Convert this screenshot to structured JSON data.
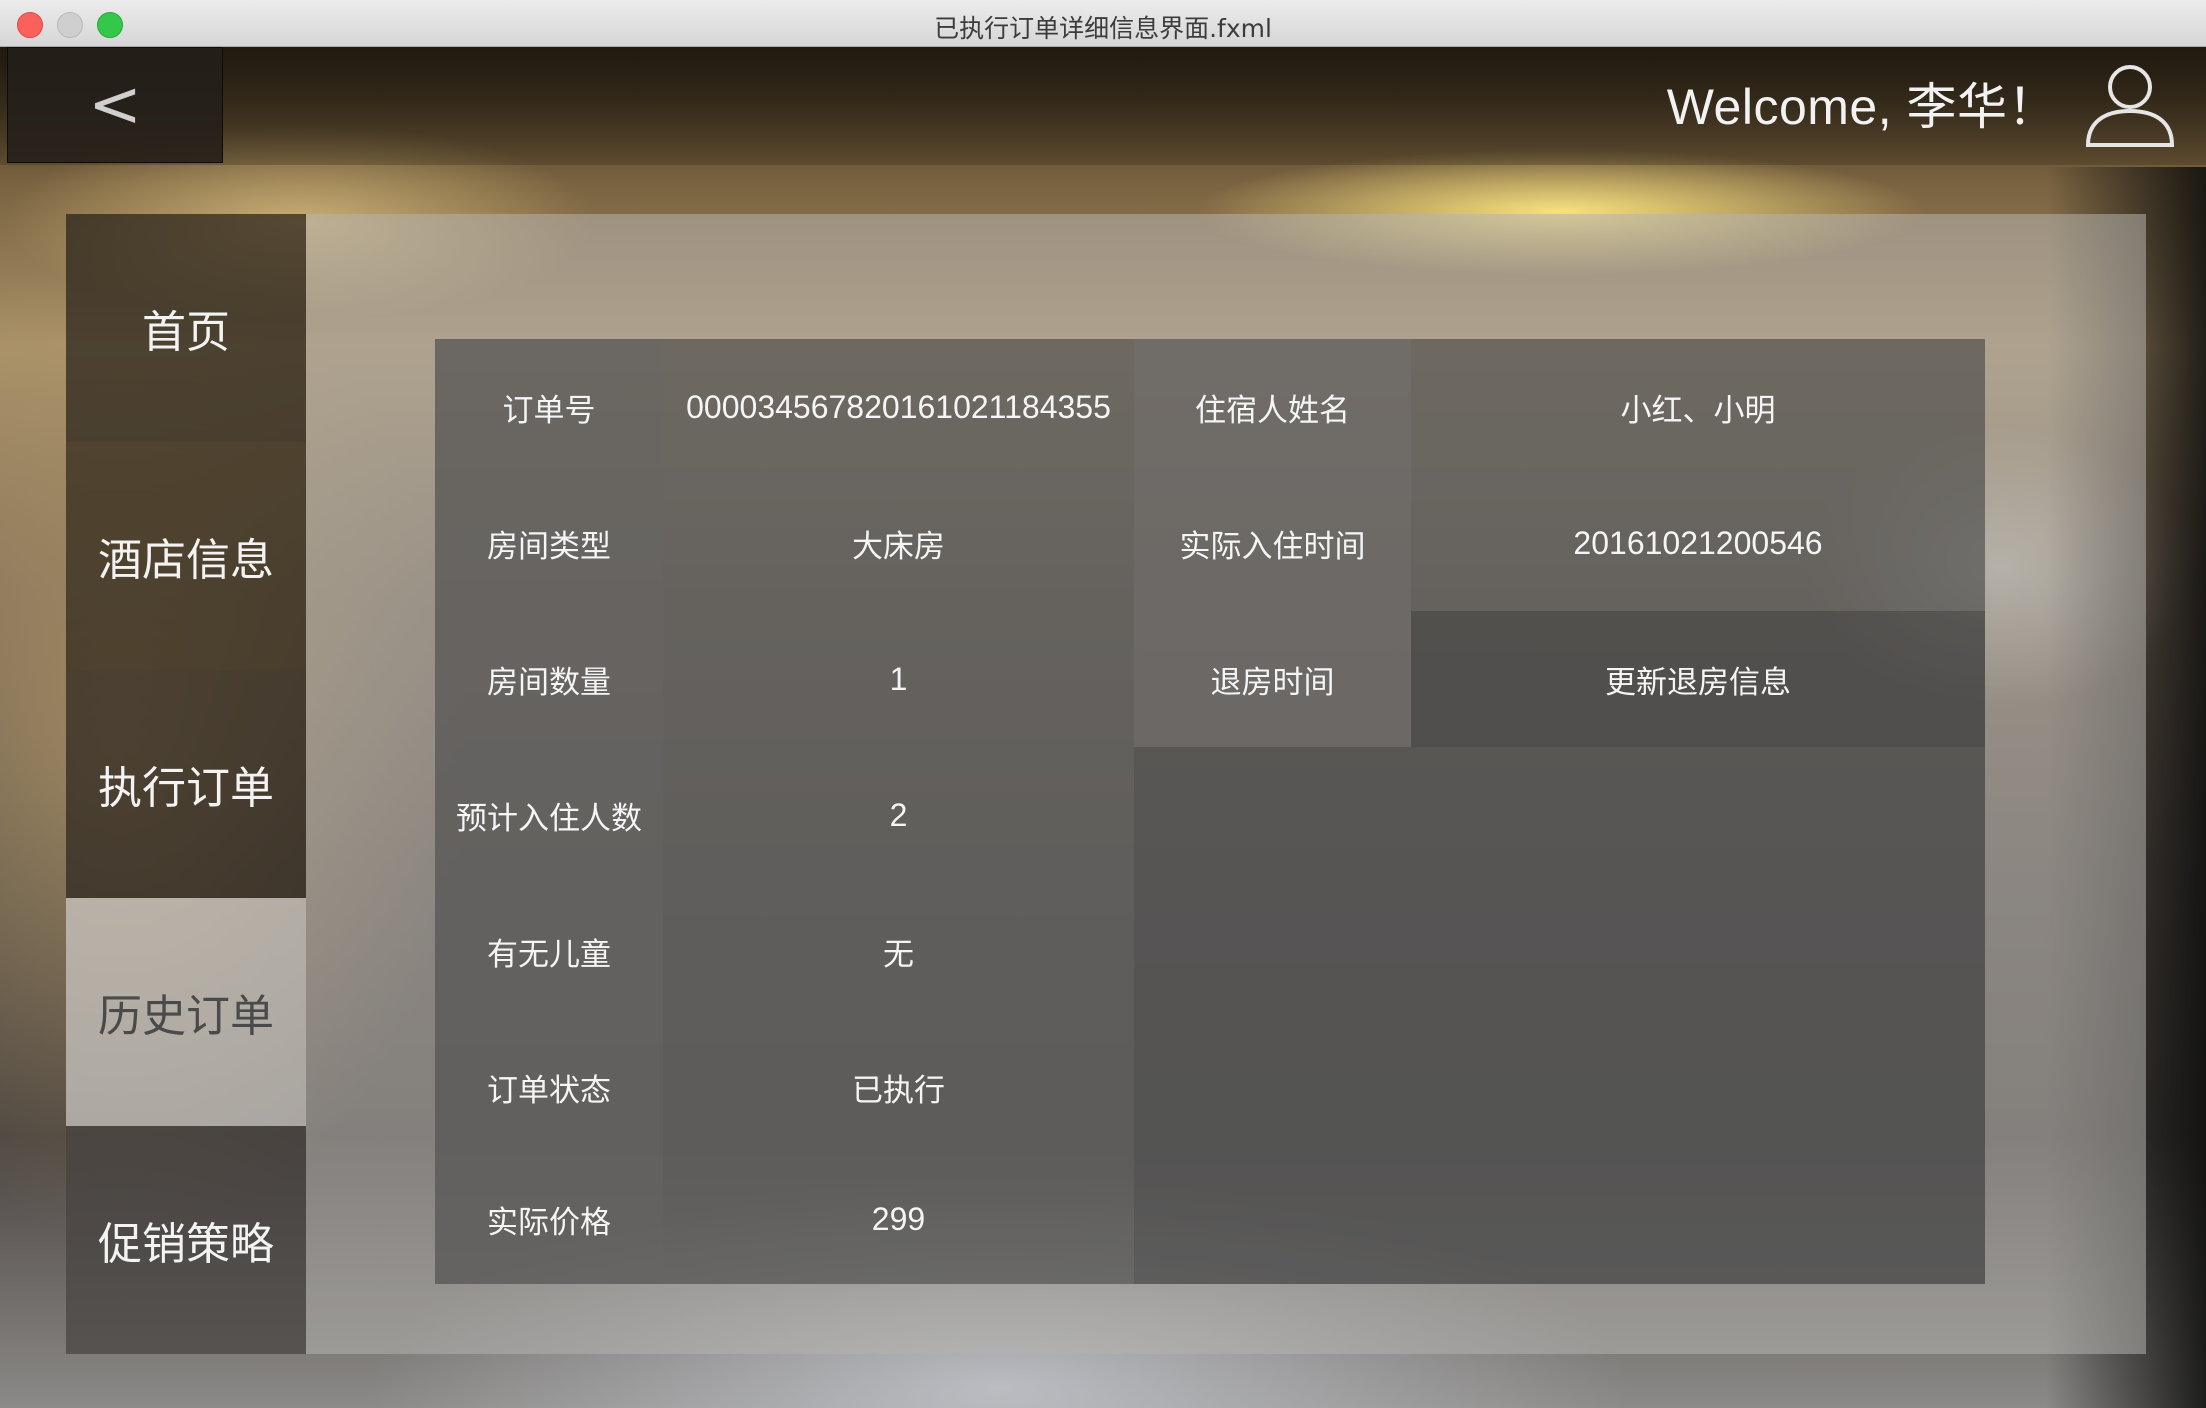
{
  "window": {
    "title": "已执行订单详细信息界面.fxml"
  },
  "header": {
    "back_label": "<",
    "welcome": "Welcome, 李华！",
    "avatar_icon": "user-icon"
  },
  "sidebar": {
    "items": [
      {
        "label": "首页",
        "selected": false
      },
      {
        "label": "酒店信息",
        "selected": false
      },
      {
        "label": "执行订单",
        "selected": false
      },
      {
        "label": "历史订单",
        "selected": true
      },
      {
        "label": "促销策略",
        "selected": false
      }
    ]
  },
  "order": {
    "left": [
      {
        "label": "订单号",
        "value": "000034567820161021184355"
      },
      {
        "label": "房间类型",
        "value": "大床房"
      },
      {
        "label": "房间数量",
        "value": "1"
      },
      {
        "label": "预计入住人数",
        "value": "2"
      },
      {
        "label": "有无儿童",
        "value": "无"
      },
      {
        "label": "订单状态",
        "value": "已执行"
      },
      {
        "label": "实际价格",
        "value": "299"
      }
    ],
    "right": [
      {
        "label": "住宿人姓名",
        "value": "小红、小明"
      },
      {
        "label": "实际入住时间",
        "value": "20161021200546"
      },
      {
        "label": "退房时间",
        "value": "更新退房信息"
      }
    ]
  }
}
